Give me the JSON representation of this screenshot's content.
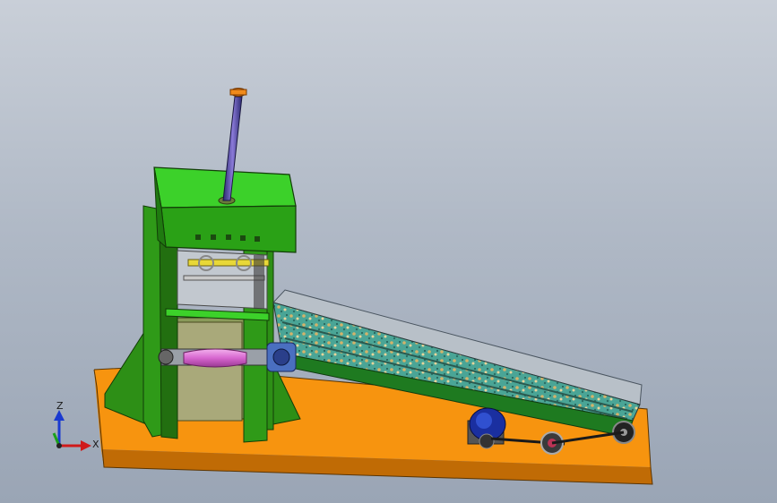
{
  "view": {
    "background_top": "#c9cfd8",
    "background_bottom": "#9aa5b5"
  },
  "colors": {
    "base": "#f7940f",
    "base_dark": "#c06b05",
    "frame_green": "#2f9a18",
    "frame_green_light": "#3cd12a",
    "frame_green_dark": "#1f6e0f",
    "conveyor_speckle": "#3a8f7f",
    "motor_blue": "#1a2fa0",
    "shaft_pink": "#e07fd8",
    "rod_purple": "#4a3c9a",
    "cap_orange": "#f08a1a"
  },
  "triad": {
    "axis_z": "Z",
    "axis_x": "X"
  },
  "parts": [
    {
      "id": "base-plate",
      "icon": "base-plate-icon"
    },
    {
      "id": "press-frame",
      "icon": "frame-icon"
    },
    {
      "id": "top-box",
      "icon": "box-icon"
    },
    {
      "id": "piston-rod",
      "icon": "rod-icon"
    },
    {
      "id": "inclined-conveyor",
      "icon": "conveyor-icon"
    },
    {
      "id": "drive-motor",
      "icon": "motor-icon"
    },
    {
      "id": "drive-shaft",
      "icon": "shaft-icon"
    }
  ]
}
